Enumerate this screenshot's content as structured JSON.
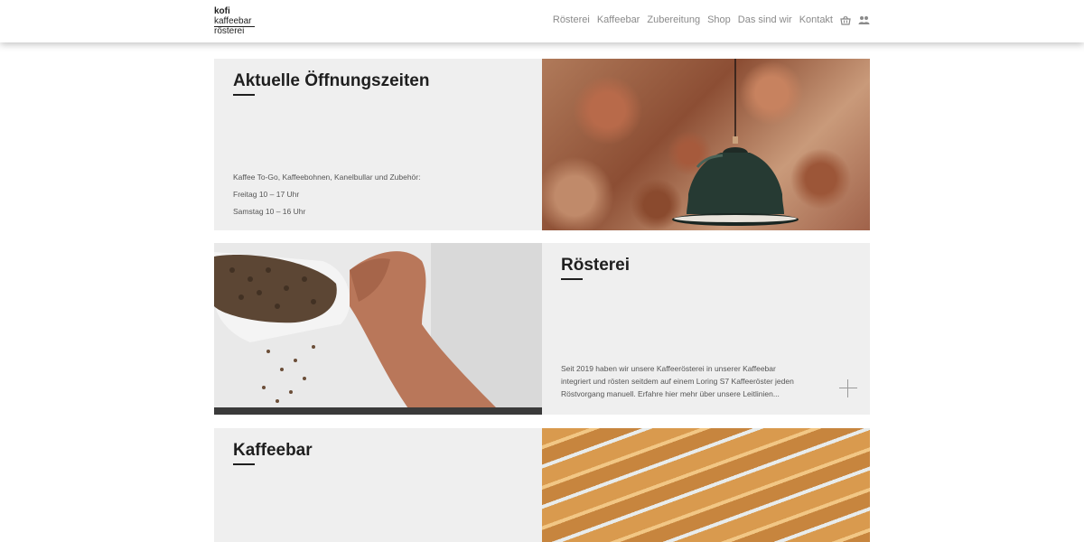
{
  "logo": {
    "line1": "kofi",
    "line2": "kaffeebar",
    "line3": "rösterei"
  },
  "nav": {
    "items": [
      "Rösterei",
      "Kaffeebar",
      "Zubereitung",
      "Shop",
      "Das sind wir",
      "Kontakt"
    ],
    "icons": [
      "basket-icon",
      "users-icon"
    ]
  },
  "hours": {
    "title": "Aktuelle Öffnungszeiten",
    "lines": [
      "Kaffee To-Go, Kaffeebohnen, Kanelbullar und Zubehör:",
      "Freitag 10 – 17 Uhr",
      "Samstag 10 – 16 Uhr"
    ]
  },
  "roasterei": {
    "title": "Rösterei",
    "text_lines": [
      "Seit 2019 haben wir unsere Kaffeerösterei in unserer Kaffeebar",
      "integriert und rösten seitdem auf einem Loring S7 Kaffeeröster jeden",
      "Röstvorgang manuell. Erfahre hier mehr über unsere Leitlinien..."
    ]
  },
  "kaffeebar": {
    "title": "Kaffeebar"
  },
  "colors": {
    "panel_bg": "#efefef",
    "text_dark": "#1f1f1f",
    "nav_text": "#8a8a8a"
  }
}
